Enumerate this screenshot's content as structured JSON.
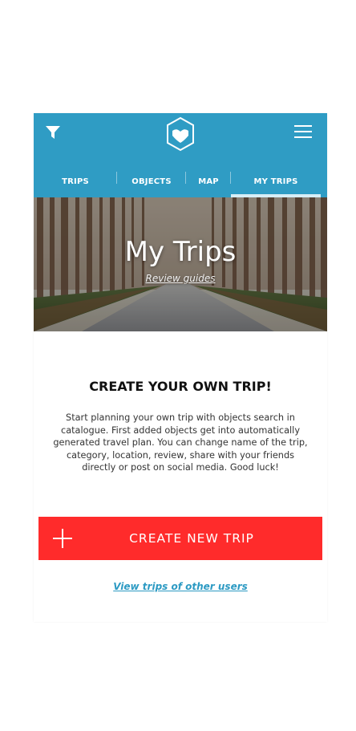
{
  "colors": {
    "header_bg": "#2f9cc4",
    "accent_red": "#ff2b2b",
    "link_blue": "#2c9ac3",
    "active_tab_indicator": "#d6eef7"
  },
  "header": {
    "left_icon": "filter-icon",
    "logo_icon": "hexagon-heart-logo",
    "right_icon": "hamburger-menu-icon"
  },
  "tabs": [
    {
      "label": "TRIPS",
      "active": false
    },
    {
      "label": "OBJECTS",
      "active": false
    },
    {
      "label": "MAP",
      "active": false
    },
    {
      "label": "MY TRIPS",
      "active": true
    }
  ],
  "hero": {
    "title": "My Trips",
    "link": "Review guides"
  },
  "main": {
    "heading": "CREATE YOUR OWN TRIP!",
    "description": "Start planning your own trip with objects search in catalogue. First added objects get into automatically generated travel plan. You can change name of the trip, category, location, review, share with your friends directly or post on social media. Good luck!",
    "create_button": "CREATE NEW TRIP",
    "create_button_icon": "plus-icon",
    "other_users_link": "View trips of other users"
  }
}
